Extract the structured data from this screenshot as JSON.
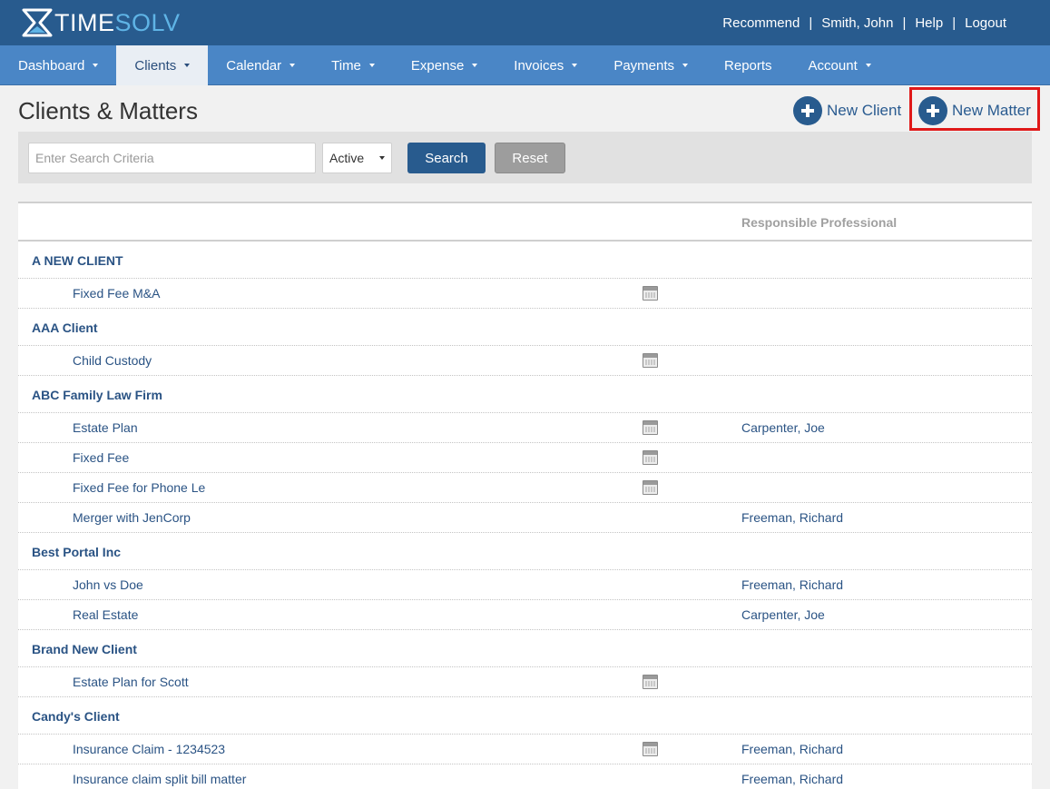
{
  "app": {
    "logo_time": "TIME",
    "logo_solv": "SOLV"
  },
  "util_links": [
    "Recommend",
    "Smith, John",
    "Help",
    "Logout"
  ],
  "nav": [
    {
      "label": "Dashboard",
      "caret": true,
      "active": false
    },
    {
      "label": "Clients",
      "caret": true,
      "active": true
    },
    {
      "label": "Calendar",
      "caret": true,
      "active": false
    },
    {
      "label": "Time",
      "caret": true,
      "active": false
    },
    {
      "label": "Expense",
      "caret": true,
      "active": false
    },
    {
      "label": "Invoices",
      "caret": true,
      "active": false
    },
    {
      "label": "Payments",
      "caret": true,
      "active": false
    },
    {
      "label": "Reports",
      "caret": false,
      "active": false
    },
    {
      "label": "Account",
      "caret": true,
      "active": false
    }
  ],
  "page": {
    "title": "Clients & Matters",
    "new_client_label": "New Client",
    "new_matter_label": "New Matter"
  },
  "search": {
    "placeholder": "Enter Search Criteria",
    "value": "",
    "status_selected": "Active",
    "search_label": "Search",
    "reset_label": "Reset"
  },
  "table": {
    "header_professional": "Responsible Professional",
    "clients": [
      {
        "name": "A NEW CLIENT",
        "matters": [
          {
            "name": "Fixed Fee M&A",
            "calendar": true,
            "professional": ""
          }
        ]
      },
      {
        "name": "AAA Client",
        "matters": [
          {
            "name": "Child Custody",
            "calendar": true,
            "professional": ""
          }
        ]
      },
      {
        "name": "ABC Family Law Firm",
        "matters": [
          {
            "name": "Estate Plan",
            "calendar": true,
            "professional": "Carpenter, Joe"
          },
          {
            "name": "Fixed Fee",
            "calendar": true,
            "professional": ""
          },
          {
            "name": "Fixed Fee for Phone Le",
            "calendar": true,
            "professional": ""
          },
          {
            "name": "Merger with JenCorp",
            "calendar": false,
            "professional": "Freeman, Richard"
          }
        ]
      },
      {
        "name": "Best Portal Inc",
        "matters": [
          {
            "name": "John vs Doe",
            "calendar": false,
            "professional": "Freeman, Richard"
          },
          {
            "name": "Real Estate",
            "calendar": false,
            "professional": "Carpenter, Joe"
          }
        ]
      },
      {
        "name": "Brand New Client",
        "matters": [
          {
            "name": "Estate Plan for Scott",
            "calendar": true,
            "professional": ""
          }
        ]
      },
      {
        "name": "Candy's Client",
        "matters": [
          {
            "name": "Insurance Claim - 1234523",
            "calendar": true,
            "professional": "Freeman, Richard"
          },
          {
            "name": "Insurance claim split bill matter",
            "calendar": false,
            "professional": "Freeman, Richard"
          }
        ]
      }
    ]
  },
  "colors": {
    "header_bg": "#285b8e",
    "nav_bg": "#4a86c6",
    "accent": "#2a5384",
    "highlight": "#e01919"
  }
}
